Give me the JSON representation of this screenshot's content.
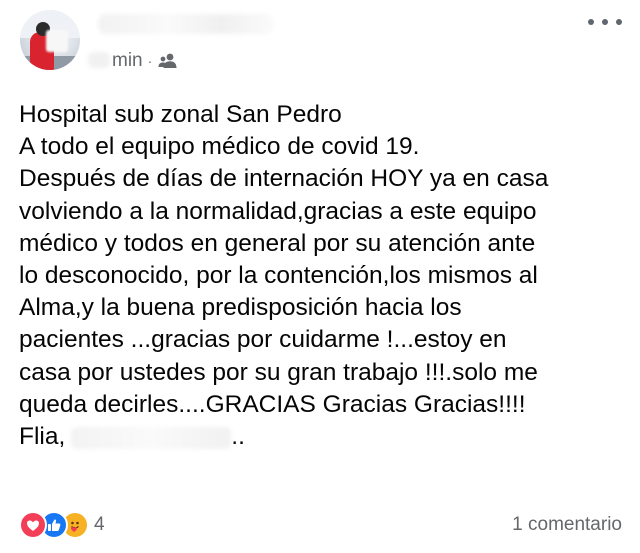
{
  "post": {
    "time_suffix": "min",
    "separator": "·",
    "audience_icon": "friends-icon",
    "body_lines": [
      "Hospital sub zonal San Pedro",
      "A todo el equipo médico de covid 19.",
      "Después de días de internación HOY ya en casa",
      "volviendo a la normalidad,gracias a este equipo",
      "médico y todos en general por su atención ante",
      "lo desconocido, por la contención,los mismos al",
      "Alma,y la buena predisposición hacia los",
      "pacientes ...gracias por cuidarme !...estoy en",
      "casa por ustedes por su gran trabajo !!!.solo me",
      "queda decirles....GRACIAS Gracias Gracias!!!!"
    ],
    "signature_prefix": "Flia,",
    "signature_suffix": ".."
  },
  "footer": {
    "reactions": [
      "love-reaction-icon",
      "like-reaction-icon",
      "care-reaction-icon"
    ],
    "reaction_count": "4",
    "comments_label": "1 comentario"
  },
  "colors": {
    "text": "#050505",
    "secondary": "#65676b",
    "like_blue": "#1877f2",
    "love_red": "#f33e58",
    "care_yellow": "#f7b125"
  }
}
